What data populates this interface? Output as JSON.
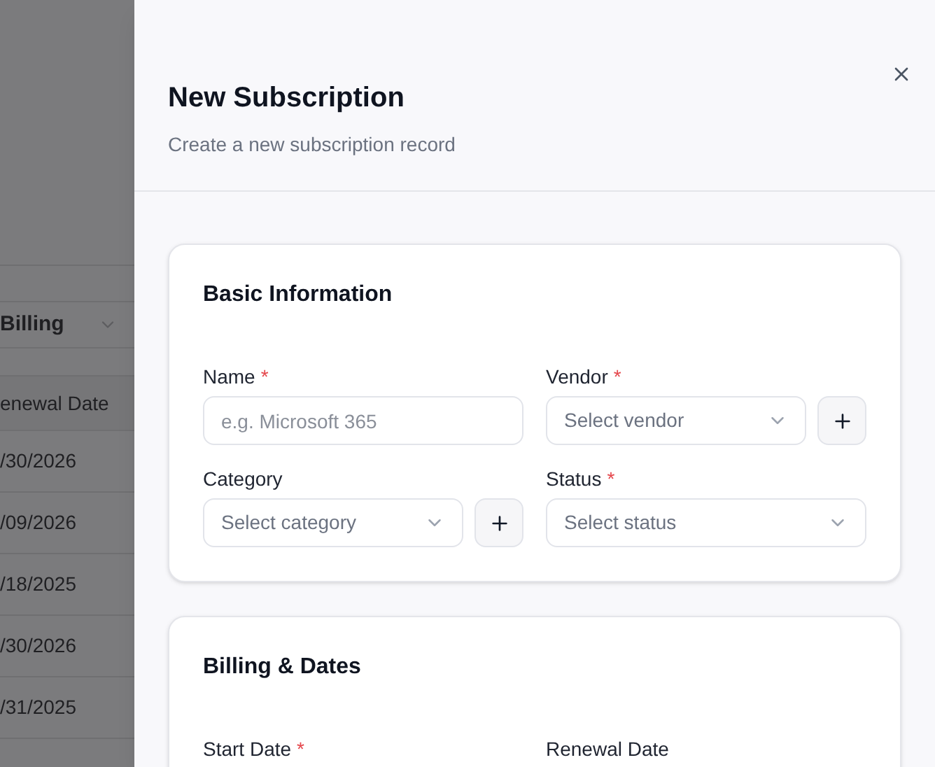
{
  "background": {
    "filter": {
      "value": "Billing"
    },
    "table": {
      "column_header": "enewal Date",
      "rows": [
        "/30/2026",
        "/09/2026",
        "/18/2025",
        "/30/2026",
        "/31/2025"
      ]
    }
  },
  "dialog": {
    "title": "New Subscription",
    "subtitle": "Create a new subscription record",
    "sections": [
      {
        "title": "Basic Information",
        "fields": [
          {
            "label": "Name",
            "required_mark": "*",
            "kind": "text",
            "placeholder": "e.g. Microsoft 365",
            "has_add": false
          },
          {
            "label": "Vendor",
            "required_mark": "*",
            "kind": "select",
            "placeholder": "Select vendor",
            "has_add": true
          },
          {
            "label": "Category",
            "kind": "select",
            "placeholder": "Select category",
            "has_add": true
          },
          {
            "label": "Status",
            "required_mark": "*",
            "kind": "select",
            "placeholder": "Select status",
            "has_add": false
          }
        ]
      },
      {
        "title": "Billing & Dates",
        "fields": [
          {
            "label": "Start Date",
            "required_mark": "*",
            "kind": "date"
          },
          {
            "label": "Renewal Date",
            "kind": "date"
          }
        ]
      }
    ]
  }
}
